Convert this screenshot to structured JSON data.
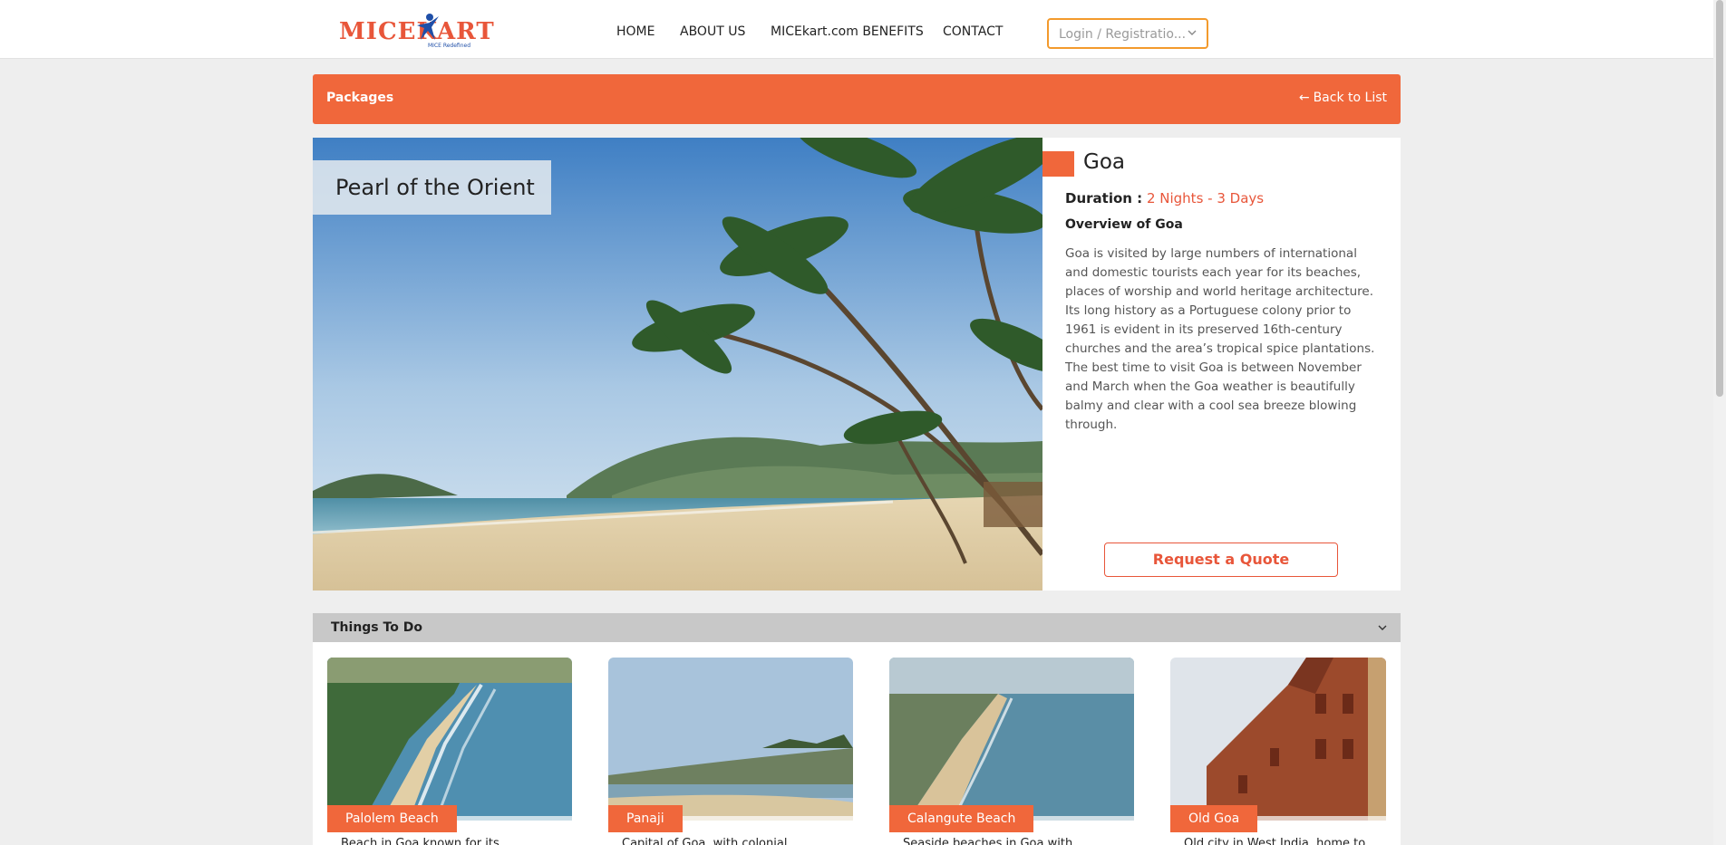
{
  "header": {
    "logo_text": "MICEKART",
    "logo_tagline": "MICE Redefined",
    "nav": [
      "HOME",
      "ABOUT US",
      "MICEkart.com BENEFITS",
      "CONTACT"
    ],
    "login_label": "Login / Registratio..."
  },
  "package_bar": {
    "title": "Packages",
    "back_label": "Back to List"
  },
  "hero": {
    "tagline": "Pearl of the Orient"
  },
  "destination": {
    "name": "Goa",
    "duration_label": "Duration :",
    "duration_value": "2 Nights - 3 Days",
    "overview_heading": "Overview of Goa",
    "overview_text": "Goa is visited by large numbers of international and domestic tourists each year for its beaches, places of worship and world heritage architecture. Its long history as a Portuguese colony prior to 1961 is evident in its preserved 16th-century churches and the area’s tropical spice plantations. The best time to visit Goa is between November and March when the Goa weather is beautifully balmy and clear with a cool sea breeze blowing through.",
    "quote_button": "Request a Quote"
  },
  "things_to_do": {
    "title": "Things To Do",
    "cards": [
      {
        "label": "Palolem Beach",
        "desc": "Beach in Goa known for its"
      },
      {
        "label": "Panaji",
        "desc": "Capital of Goa, with colonial"
      },
      {
        "label": "Calangute Beach",
        "desc": "Seaside beaches in Goa with"
      },
      {
        "label": "Old Goa",
        "desc": "Old city in West India, home to"
      }
    ]
  },
  "colors": {
    "accent": "#f0673b",
    "login_border": "#f39a2c"
  }
}
